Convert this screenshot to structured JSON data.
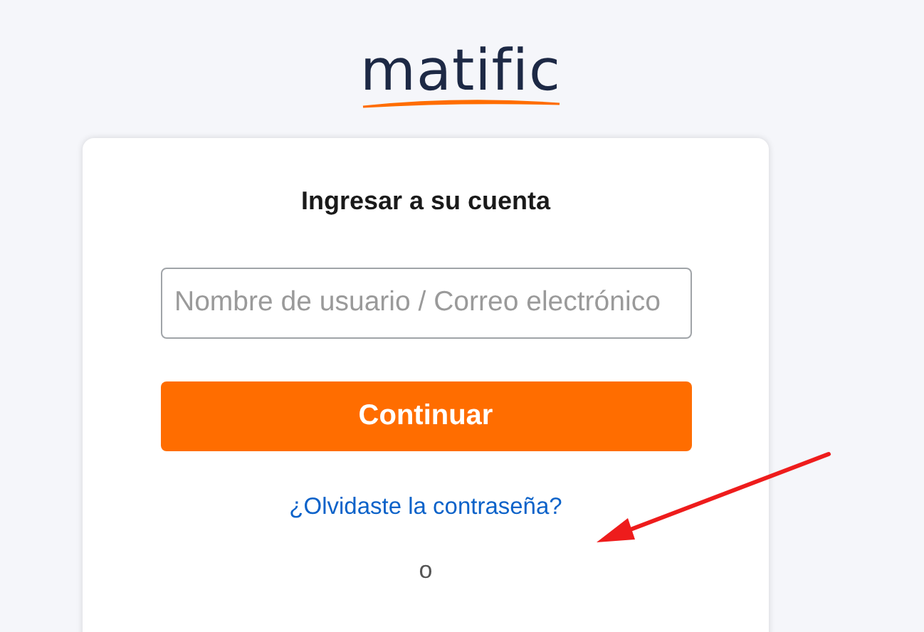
{
  "logo": {
    "text": "matific"
  },
  "login_card": {
    "title": "Ingresar a su cuenta",
    "username_field": {
      "placeholder": "Nombre de usuario / Correo electrónico"
    },
    "continue_button": "Continuar",
    "forgot_password_link": "¿Olvidaste la contraseña?",
    "separator": "o"
  }
}
